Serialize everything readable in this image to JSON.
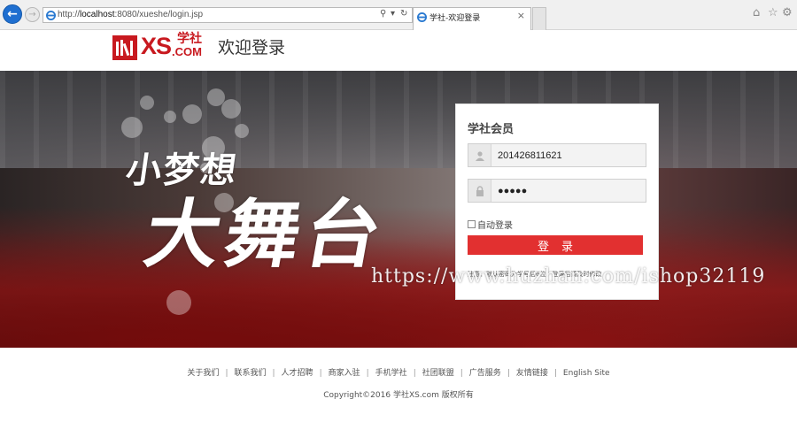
{
  "browser": {
    "url_prefix": "http://",
    "url_host": "localhost",
    "url_rest": ":8080/xueshe/login.jsp",
    "tab_title": "学社-欢迎登录",
    "tab_close": "×",
    "back_icon": "arrow-left",
    "forward_icon": "arrow-right"
  },
  "header": {
    "logo_text": "XS",
    "logo_cn": "学社",
    "logo_com": ".COM",
    "title": "欢迎登录"
  },
  "banner": {
    "slogan_small": "小梦想",
    "slogan_big": "大舞台"
  },
  "login": {
    "heading": "学社会员",
    "username_value": "2014268116​21",
    "password_value": "●●●●●",
    "remember_label": "自动登录",
    "submit_label": "登录",
    "notice": "注意：默认密码为学号后6位，登录后请及时修改"
  },
  "watermark": "https://www.huzhan.com/ishop32119",
  "footer": {
    "links": [
      "关于我们",
      "联系我们",
      "人才招聘",
      "商家入驻",
      "手机学社",
      "社团联盟",
      "广告服务",
      "友情链接",
      "English Site"
    ],
    "separator": "|",
    "copyright": "Copyright©2016 学社XS.com 版权所有"
  },
  "colors": {
    "brand_red": "#c8191f",
    "button_red": "#e23030"
  }
}
